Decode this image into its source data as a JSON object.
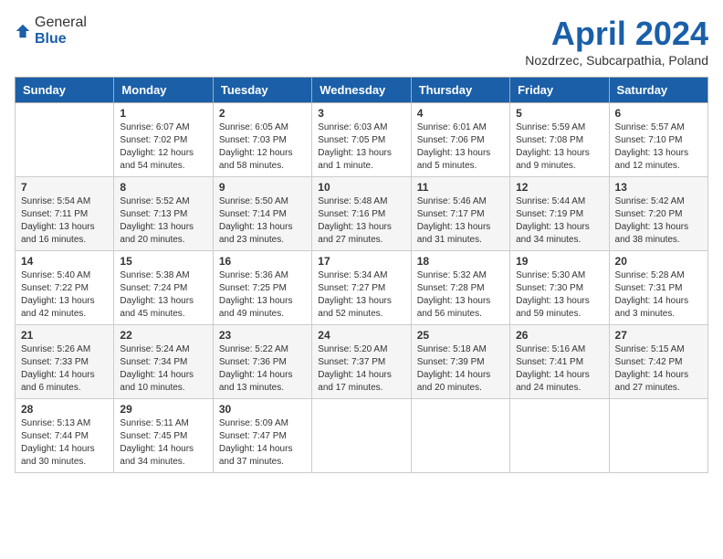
{
  "header": {
    "logo_general": "General",
    "logo_blue": "Blue",
    "title": "April 2024",
    "subtitle": "Nozdrzec, Subcarpathia, Poland"
  },
  "weekdays": [
    "Sunday",
    "Monday",
    "Tuesday",
    "Wednesday",
    "Thursday",
    "Friday",
    "Saturday"
  ],
  "weeks": [
    [
      {
        "date": "",
        "sunrise": "",
        "sunset": "",
        "daylight": ""
      },
      {
        "date": "1",
        "sunrise": "Sunrise: 6:07 AM",
        "sunset": "Sunset: 7:02 PM",
        "daylight": "Daylight: 12 hours and 54 minutes."
      },
      {
        "date": "2",
        "sunrise": "Sunrise: 6:05 AM",
        "sunset": "Sunset: 7:03 PM",
        "daylight": "Daylight: 12 hours and 58 minutes."
      },
      {
        "date": "3",
        "sunrise": "Sunrise: 6:03 AM",
        "sunset": "Sunset: 7:05 PM",
        "daylight": "Daylight: 13 hours and 1 minute."
      },
      {
        "date": "4",
        "sunrise": "Sunrise: 6:01 AM",
        "sunset": "Sunset: 7:06 PM",
        "daylight": "Daylight: 13 hours and 5 minutes."
      },
      {
        "date": "5",
        "sunrise": "Sunrise: 5:59 AM",
        "sunset": "Sunset: 7:08 PM",
        "daylight": "Daylight: 13 hours and 9 minutes."
      },
      {
        "date": "6",
        "sunrise": "Sunrise: 5:57 AM",
        "sunset": "Sunset: 7:10 PM",
        "daylight": "Daylight: 13 hours and 12 minutes."
      }
    ],
    [
      {
        "date": "7",
        "sunrise": "Sunrise: 5:54 AM",
        "sunset": "Sunset: 7:11 PM",
        "daylight": "Daylight: 13 hours and 16 minutes."
      },
      {
        "date": "8",
        "sunrise": "Sunrise: 5:52 AM",
        "sunset": "Sunset: 7:13 PM",
        "daylight": "Daylight: 13 hours and 20 minutes."
      },
      {
        "date": "9",
        "sunrise": "Sunrise: 5:50 AM",
        "sunset": "Sunset: 7:14 PM",
        "daylight": "Daylight: 13 hours and 23 minutes."
      },
      {
        "date": "10",
        "sunrise": "Sunrise: 5:48 AM",
        "sunset": "Sunset: 7:16 PM",
        "daylight": "Daylight: 13 hours and 27 minutes."
      },
      {
        "date": "11",
        "sunrise": "Sunrise: 5:46 AM",
        "sunset": "Sunset: 7:17 PM",
        "daylight": "Daylight: 13 hours and 31 minutes."
      },
      {
        "date": "12",
        "sunrise": "Sunrise: 5:44 AM",
        "sunset": "Sunset: 7:19 PM",
        "daylight": "Daylight: 13 hours and 34 minutes."
      },
      {
        "date": "13",
        "sunrise": "Sunrise: 5:42 AM",
        "sunset": "Sunset: 7:20 PM",
        "daylight": "Daylight: 13 hours and 38 minutes."
      }
    ],
    [
      {
        "date": "14",
        "sunrise": "Sunrise: 5:40 AM",
        "sunset": "Sunset: 7:22 PM",
        "daylight": "Daylight: 13 hours and 42 minutes."
      },
      {
        "date": "15",
        "sunrise": "Sunrise: 5:38 AM",
        "sunset": "Sunset: 7:24 PM",
        "daylight": "Daylight: 13 hours and 45 minutes."
      },
      {
        "date": "16",
        "sunrise": "Sunrise: 5:36 AM",
        "sunset": "Sunset: 7:25 PM",
        "daylight": "Daylight: 13 hours and 49 minutes."
      },
      {
        "date": "17",
        "sunrise": "Sunrise: 5:34 AM",
        "sunset": "Sunset: 7:27 PM",
        "daylight": "Daylight: 13 hours and 52 minutes."
      },
      {
        "date": "18",
        "sunrise": "Sunrise: 5:32 AM",
        "sunset": "Sunset: 7:28 PM",
        "daylight": "Daylight: 13 hours and 56 minutes."
      },
      {
        "date": "19",
        "sunrise": "Sunrise: 5:30 AM",
        "sunset": "Sunset: 7:30 PM",
        "daylight": "Daylight: 13 hours and 59 minutes."
      },
      {
        "date": "20",
        "sunrise": "Sunrise: 5:28 AM",
        "sunset": "Sunset: 7:31 PM",
        "daylight": "Daylight: 14 hours and 3 minutes."
      }
    ],
    [
      {
        "date": "21",
        "sunrise": "Sunrise: 5:26 AM",
        "sunset": "Sunset: 7:33 PM",
        "daylight": "Daylight: 14 hours and 6 minutes."
      },
      {
        "date": "22",
        "sunrise": "Sunrise: 5:24 AM",
        "sunset": "Sunset: 7:34 PM",
        "daylight": "Daylight: 14 hours and 10 minutes."
      },
      {
        "date": "23",
        "sunrise": "Sunrise: 5:22 AM",
        "sunset": "Sunset: 7:36 PM",
        "daylight": "Daylight: 14 hours and 13 minutes."
      },
      {
        "date": "24",
        "sunrise": "Sunrise: 5:20 AM",
        "sunset": "Sunset: 7:37 PM",
        "daylight": "Daylight: 14 hours and 17 minutes."
      },
      {
        "date": "25",
        "sunrise": "Sunrise: 5:18 AM",
        "sunset": "Sunset: 7:39 PM",
        "daylight": "Daylight: 14 hours and 20 minutes."
      },
      {
        "date": "26",
        "sunrise": "Sunrise: 5:16 AM",
        "sunset": "Sunset: 7:41 PM",
        "daylight": "Daylight: 14 hours and 24 minutes."
      },
      {
        "date": "27",
        "sunrise": "Sunrise: 5:15 AM",
        "sunset": "Sunset: 7:42 PM",
        "daylight": "Daylight: 14 hours and 27 minutes."
      }
    ],
    [
      {
        "date": "28",
        "sunrise": "Sunrise: 5:13 AM",
        "sunset": "Sunset: 7:44 PM",
        "daylight": "Daylight: 14 hours and 30 minutes."
      },
      {
        "date": "29",
        "sunrise": "Sunrise: 5:11 AM",
        "sunset": "Sunset: 7:45 PM",
        "daylight": "Daylight: 14 hours and 34 minutes."
      },
      {
        "date": "30",
        "sunrise": "Sunrise: 5:09 AM",
        "sunset": "Sunset: 7:47 PM",
        "daylight": "Daylight: 14 hours and 37 minutes."
      },
      {
        "date": "",
        "sunrise": "",
        "sunset": "",
        "daylight": ""
      },
      {
        "date": "",
        "sunrise": "",
        "sunset": "",
        "daylight": ""
      },
      {
        "date": "",
        "sunrise": "",
        "sunset": "",
        "daylight": ""
      },
      {
        "date": "",
        "sunrise": "",
        "sunset": "",
        "daylight": ""
      }
    ]
  ]
}
